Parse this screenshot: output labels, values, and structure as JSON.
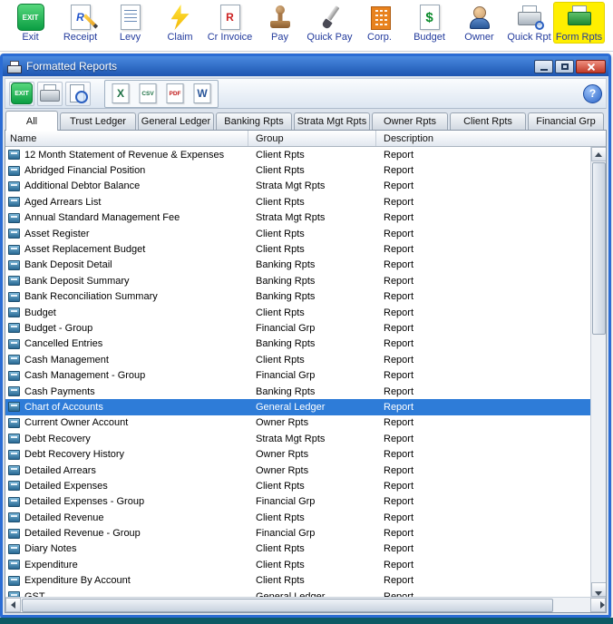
{
  "app_toolbar": {
    "items": [
      {
        "label": "Exit",
        "icon": "exit",
        "icon_text": "EXIT"
      },
      {
        "label": "Receipt",
        "icon": "receipt",
        "icon_text": "R"
      },
      {
        "label": "Levy",
        "icon": "levy"
      },
      {
        "label": "Claim",
        "icon": "claim"
      },
      {
        "label": "Cr Invoice",
        "icon": "cr-invoice",
        "icon_text": "R"
      },
      {
        "label": "Pay",
        "icon": "pay"
      },
      {
        "label": "Quick Pay",
        "icon": "quick-pay"
      },
      {
        "label": "Corp.",
        "icon": "corp"
      },
      {
        "label": "Budget",
        "icon": "budget",
        "icon_text": "$"
      },
      {
        "label": "Owner",
        "icon": "owner"
      },
      {
        "label": "Quick Rpt",
        "icon": "quick-rpt"
      },
      {
        "label": "Form Rpts",
        "icon": "form-rpts",
        "highlighted": true
      }
    ]
  },
  "dialog": {
    "title": "Formatted Reports",
    "toolbar": {
      "buttons": [
        {
          "name": "exit-button",
          "icon": "exit",
          "icon_text": "EXIT"
        },
        {
          "name": "print-button",
          "icon": "print"
        },
        {
          "name": "print-preview-button",
          "icon": "preview"
        },
        {
          "name": "export-excel-button",
          "icon": "excel",
          "icon_text": "X",
          "group": "export"
        },
        {
          "name": "export-csv-button",
          "icon": "csv",
          "icon_text": "CSV",
          "group": "export"
        },
        {
          "name": "export-pdf-button",
          "icon": "pdf",
          "icon_text": "PDF",
          "group": "export"
        },
        {
          "name": "export-word-button",
          "icon": "word",
          "icon_text": "W",
          "group": "export"
        }
      ],
      "help_icon_text": "?"
    },
    "tabs": [
      "All",
      "Trust Ledger",
      "General Ledger",
      "Banking Rpts",
      "Strata Mgt Rpts",
      "Owner Rpts",
      "Client Rpts",
      "Financial Grp"
    ],
    "active_tab": "All",
    "table": {
      "columns": [
        "Name",
        "Group",
        "Description"
      ],
      "selected": "Chart of Accounts",
      "rows": [
        {
          "name": "12 Month Statement of Revenue & Expenses",
          "group": "Client Rpts",
          "description": "Report"
        },
        {
          "name": "Abridged Financial Position",
          "group": "Client Rpts",
          "description": "Report"
        },
        {
          "name": "Additional Debtor Balance",
          "group": "Strata Mgt Rpts",
          "description": "Report"
        },
        {
          "name": "Aged Arrears List",
          "group": "Client Rpts",
          "description": "Report"
        },
        {
          "name": "Annual Standard Management Fee",
          "group": "Strata Mgt Rpts",
          "description": "Report"
        },
        {
          "name": "Asset Register",
          "group": "Client Rpts",
          "description": "Report"
        },
        {
          "name": "Asset Replacement Budget",
          "group": "Client Rpts",
          "description": "Report"
        },
        {
          "name": "Bank Deposit Detail",
          "group": "Banking Rpts",
          "description": "Report"
        },
        {
          "name": "Bank Deposit Summary",
          "group": "Banking Rpts",
          "description": "Report"
        },
        {
          "name": "Bank Reconciliation Summary",
          "group": "Banking Rpts",
          "description": "Report"
        },
        {
          "name": "Budget",
          "group": "Client Rpts",
          "description": "Report"
        },
        {
          "name": "Budget - Group",
          "group": "Financial Grp",
          "description": "Report"
        },
        {
          "name": "Cancelled Entries",
          "group": "Banking Rpts",
          "description": "Report"
        },
        {
          "name": "Cash Management",
          "group": "Client Rpts",
          "description": "Report"
        },
        {
          "name": "Cash Management - Group",
          "group": "Financial Grp",
          "description": "Report"
        },
        {
          "name": "Cash Payments",
          "group": "Banking Rpts",
          "description": "Report"
        },
        {
          "name": "Chart of Accounts",
          "group": "General Ledger",
          "description": "Report"
        },
        {
          "name": "Current Owner Account",
          "group": "Owner Rpts",
          "description": "Report"
        },
        {
          "name": "Debt Recovery",
          "group": "Strata Mgt Rpts",
          "description": "Report"
        },
        {
          "name": "Debt Recovery History",
          "group": "Owner Rpts",
          "description": "Report"
        },
        {
          "name": "Detailed Arrears",
          "group": "Owner Rpts",
          "description": "Report"
        },
        {
          "name": "Detailed Expenses",
          "group": "Client Rpts",
          "description": "Report"
        },
        {
          "name": "Detailed Expenses - Group",
          "group": "Financial Grp",
          "description": "Report"
        },
        {
          "name": "Detailed Revenue",
          "group": "Client Rpts",
          "description": "Report"
        },
        {
          "name": "Detailed Revenue - Group",
          "group": "Financial Grp",
          "description": "Report"
        },
        {
          "name": "Diary Notes",
          "group": "Client Rpts",
          "description": "Report"
        },
        {
          "name": "Expenditure",
          "group": "Client Rpts",
          "description": "Report"
        },
        {
          "name": "Expenditure By Account",
          "group": "Client Rpts",
          "description": "Report"
        },
        {
          "name": "GST",
          "group": "General Ledger",
          "description": "Report"
        }
      ]
    }
  },
  "colors": {
    "title_bar": "#2b6cd4",
    "selection": "#2e7cd8",
    "toolbar_highlight": "#ffef00",
    "bottom_edge": "#0d5a64"
  }
}
